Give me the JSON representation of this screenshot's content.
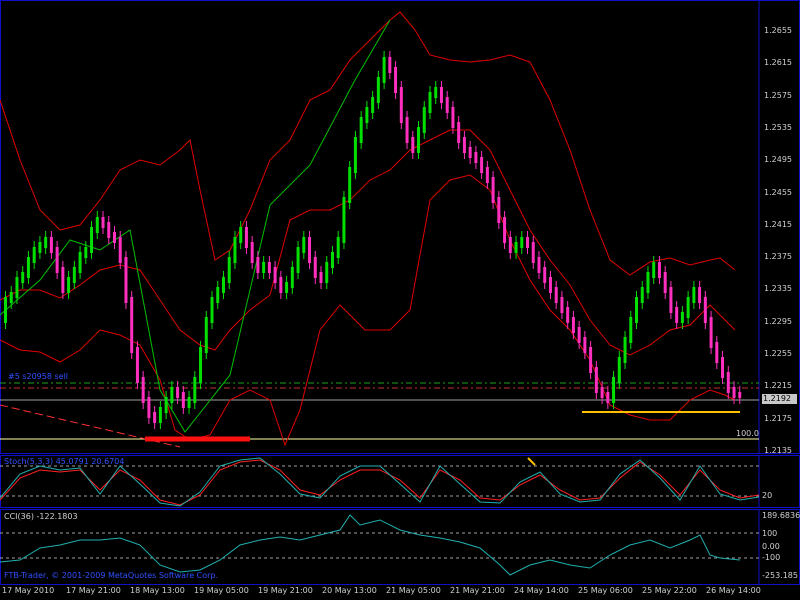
{
  "main_chart": {
    "price_ticks": [
      "1.2655",
      "1.2615",
      "1.2575",
      "1.2535",
      "1.2495",
      "1.2455",
      "1.2415",
      "1.2375",
      "1.2335",
      "1.2295",
      "1.2255",
      "1.2215",
      "1.2175",
      "1.2135"
    ],
    "current_price_tag": "1.2192",
    "level_label": "100.0",
    "sell_label": "#5 s20958 sell"
  },
  "stochastic": {
    "title": "Stoch(5,3,3) 45.0791 20.6704",
    "level_label": "20"
  },
  "cci": {
    "title": "CCI(36) -122.1803",
    "ticks": [
      "189.6836",
      "100",
      "0.00",
      "-100",
      "-253.185"
    ]
  },
  "watermark": "FTB-Trader, © 2001-2009 MetaQuotes Software Corp.",
  "time_axis": [
    "17 May 2010",
    "17 May 21:00",
    "18 May 13:00",
    "19 May 05:00",
    "19 May 21:00",
    "20 May 13:00",
    "21 May 05:00",
    "21 May 21:00",
    "24 May 14:00",
    "25 May 06:00",
    "25 May 22:00",
    "26 May 14:00"
  ],
  "colors": {
    "bull_candle": "#00e000",
    "bear_candle": "#ff30c0",
    "bands": "#e00000",
    "zigzag": "#00c000",
    "support_line": "#ffc000",
    "border": "#1010c8",
    "stoch_main": "#20b0b0",
    "stoch_signal": "#ff2020",
    "cci_line": "#20b0b0"
  }
}
